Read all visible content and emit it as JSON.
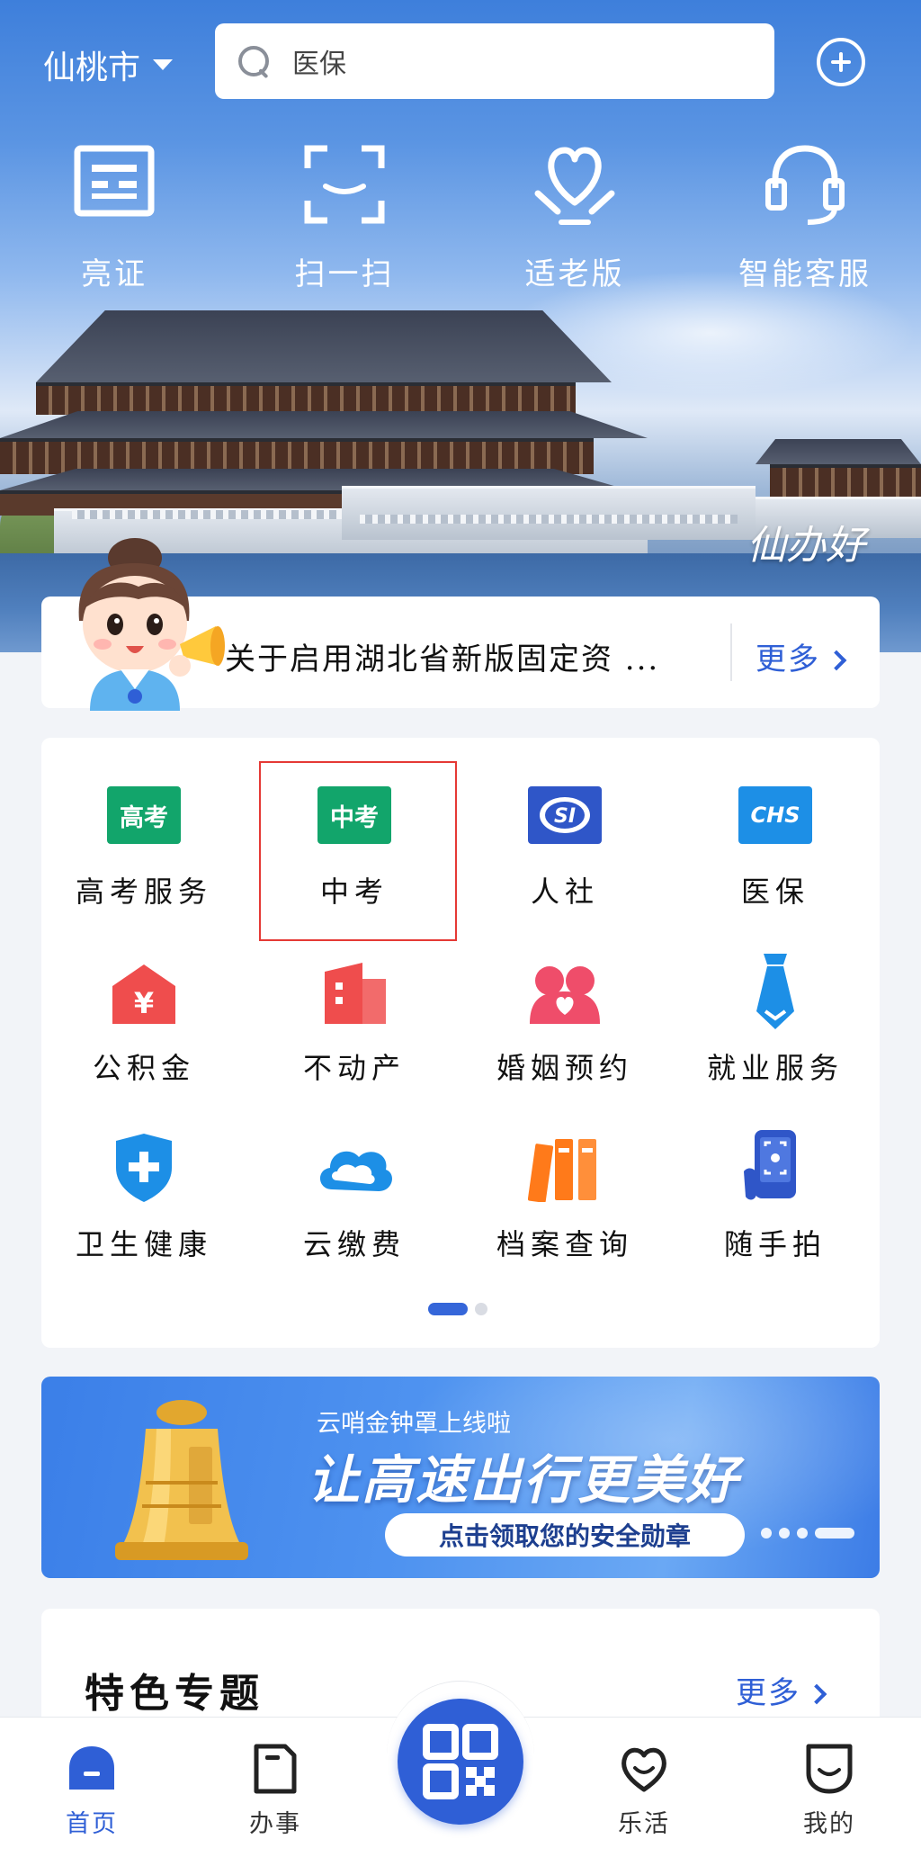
{
  "header": {
    "city": "仙桃市",
    "search_placeholder": "医保",
    "add_label": "+"
  },
  "quick_actions": [
    {
      "label": "亮证",
      "icon": "id-card-icon"
    },
    {
      "label": "扫一扫",
      "icon": "scan-icon"
    },
    {
      "label": "适老版",
      "icon": "elder-heart-icon"
    },
    {
      "label": "智能客服",
      "icon": "headset-icon"
    }
  ],
  "hero": {
    "slogan": "仙办好"
  },
  "notice": {
    "text": "关于启用湖北省新版固定资 ...",
    "more": "更多"
  },
  "services": [
    {
      "label": "高考服务",
      "badge": "高考",
      "color": "#12a56b"
    },
    {
      "label": "中考",
      "badge": "中考",
      "color": "#12a56b"
    },
    {
      "label": "人社",
      "badge": "SI",
      "color": "#2f56c8"
    },
    {
      "label": "医保",
      "badge": "CHS",
      "color": "#1d8fe6"
    },
    {
      "label": "公积金",
      "icon": "house-yuan-icon",
      "color": "#ef4d4d"
    },
    {
      "label": "不动产",
      "icon": "building-icon",
      "color": "#ef4d4d"
    },
    {
      "label": "婚姻预约",
      "icon": "couple-heart-icon",
      "color": "#ef4d6a"
    },
    {
      "label": "就业服务",
      "icon": "tie-icon",
      "color": "#1d8fe6"
    },
    {
      "label": "卫生健康",
      "icon": "medical-shield-icon",
      "color": "#1d8fe6"
    },
    {
      "label": "云缴费",
      "icon": "cloud-icon",
      "color": "#1d8fe6"
    },
    {
      "label": "档案查询",
      "icon": "folders-icon",
      "color": "#ff7a1a"
    },
    {
      "label": "随手拍",
      "icon": "phone-camera-icon",
      "color": "#2f56c8"
    }
  ],
  "banner": {
    "subtitle": "云哨金钟罩上线啦",
    "title": "让高速出行更美好",
    "button": "点击领取您的安全勋章"
  },
  "featured": {
    "title": "特色专题",
    "more": "更多"
  },
  "bottom_nav": [
    {
      "label": "首页",
      "active": true
    },
    {
      "label": "办事",
      "active": false
    },
    {
      "label": "乐活",
      "active": false
    },
    {
      "label": "我的",
      "active": false
    }
  ],
  "colors": {
    "accent": "#2f5fd6",
    "highlight_border": "#e53935"
  }
}
